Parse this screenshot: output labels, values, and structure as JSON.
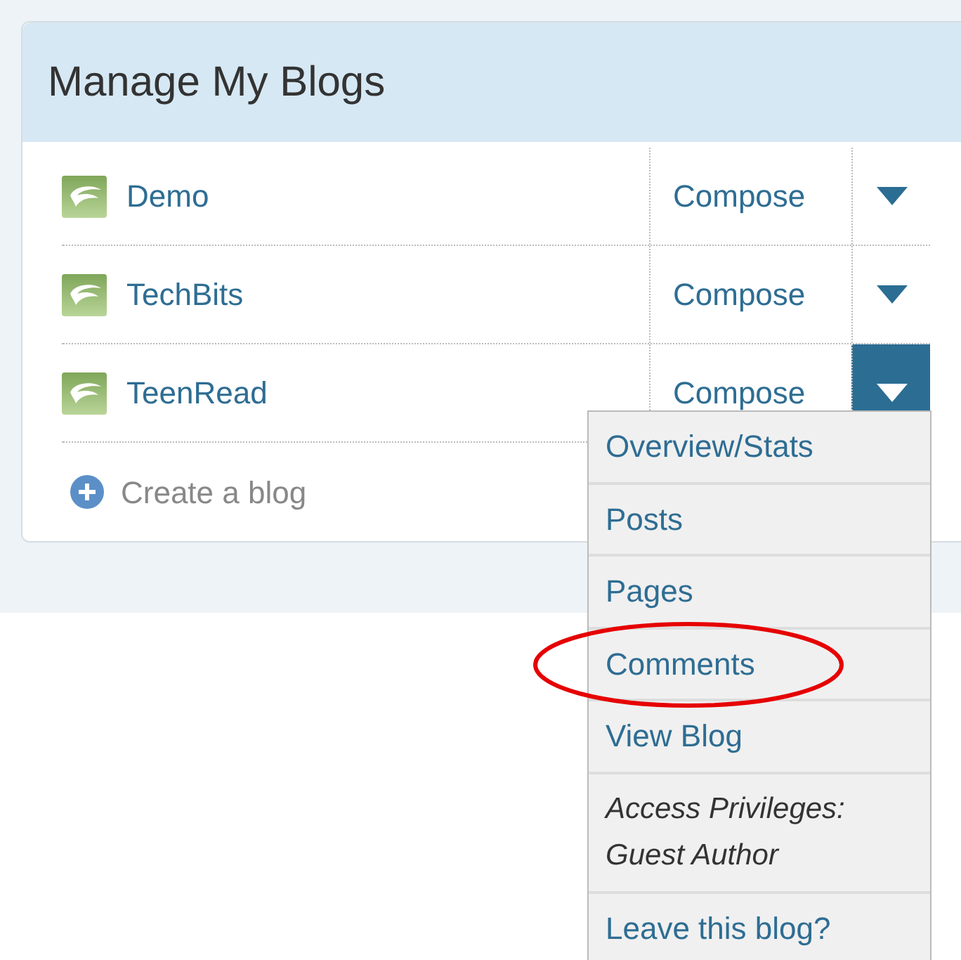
{
  "panel": {
    "title": "Manage My Blogs"
  },
  "blogs": [
    {
      "name": "Demo",
      "action": "Compose",
      "open": false
    },
    {
      "name": "TechBits",
      "action": "Compose",
      "open": false
    },
    {
      "name": "TeenRead",
      "action": "Compose",
      "open": true
    }
  ],
  "create": {
    "label": "Create a blog"
  },
  "menu": [
    {
      "kind": "link",
      "label": "Overview/Stats",
      "circled": false
    },
    {
      "kind": "link",
      "label": "Posts",
      "circled": false
    },
    {
      "kind": "link",
      "label": "Pages",
      "circled": false
    },
    {
      "kind": "link",
      "label": "Comments",
      "circled": true
    },
    {
      "kind": "link",
      "label": "View Blog",
      "circled": false
    },
    {
      "kind": "note",
      "lines": [
        "Access Privileges:",
        "Guest Author"
      ],
      "circled": false
    },
    {
      "kind": "link",
      "label": "Leave this blog?",
      "circled": false
    }
  ]
}
